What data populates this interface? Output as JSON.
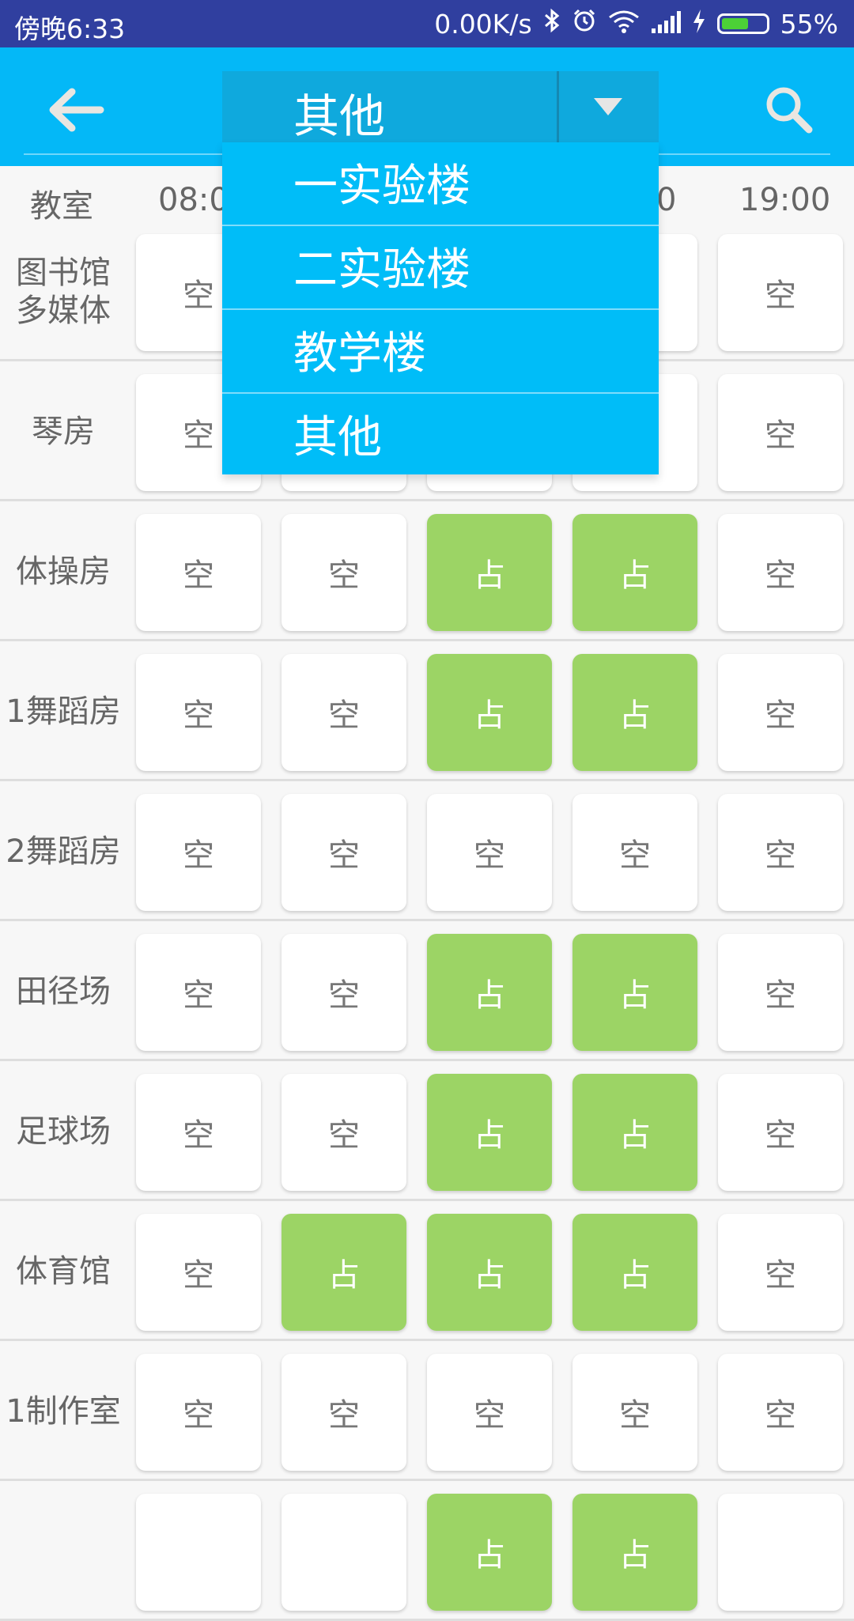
{
  "status_bar": {
    "time": "傍晚6:33",
    "net_speed": "0.00K/s",
    "battery_percent": "55%",
    "battery_level": 0.55,
    "icons": [
      "bluetooth-icon",
      "alarm-icon",
      "wifi-icon",
      "signal-icon",
      "charging-icon",
      "battery-icon"
    ]
  },
  "app_bar": {
    "selected_building": "其他",
    "back_icon": "arrow-left-icon",
    "search_icon": "search-icon"
  },
  "dropdown": {
    "options": [
      "一实验楼",
      "二实验楼",
      "教学楼",
      "其他"
    ]
  },
  "table": {
    "room_header": "教室",
    "time_headers": [
      "08:0",
      "0",
      "19:00"
    ],
    "rows": [
      {
        "room": "图书馆\n多媒体",
        "cells": [
          "空",
          "",
          "",
          "",
          "空"
        ]
      },
      {
        "room": "琴房",
        "cells": [
          "空",
          "",
          "",
          "",
          "空"
        ]
      },
      {
        "room": "体操房",
        "cells": [
          "空",
          "空",
          "占",
          "占",
          "空"
        ]
      },
      {
        "room": "1舞蹈房",
        "cells": [
          "空",
          "空",
          "占",
          "占",
          "空"
        ]
      },
      {
        "room": "2舞蹈房",
        "cells": [
          "空",
          "空",
          "空",
          "空",
          "空"
        ]
      },
      {
        "room": "田径场",
        "cells": [
          "空",
          "空",
          "占",
          "占",
          "空"
        ]
      },
      {
        "room": "足球场",
        "cells": [
          "空",
          "空",
          "占",
          "占",
          "空"
        ]
      },
      {
        "room": "体育馆",
        "cells": [
          "空",
          "占",
          "占",
          "占",
          "空"
        ]
      },
      {
        "room": "1制作室",
        "cells": [
          "空",
          "空",
          "空",
          "空",
          "空"
        ]
      },
      {
        "room": "",
        "cells": [
          "",
          "",
          "占",
          "占",
          ""
        ]
      }
    ]
  },
  "colors": {
    "status_bar": "#303f9f",
    "app_bar": "#04b8f7",
    "dropdown": "#00bdf8",
    "occupied": "#9cd465",
    "free": "#ffffff"
  }
}
